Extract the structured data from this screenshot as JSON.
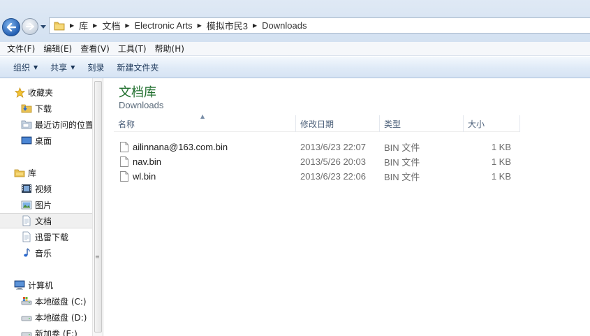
{
  "address_bar": {
    "crumbs": [
      "库",
      "文档",
      "Electronic Arts",
      "模拟市民3",
      "Downloads"
    ]
  },
  "menu": [
    "文件(F)",
    "编辑(E)",
    "查看(V)",
    "工具(T)",
    "帮助(H)"
  ],
  "commands": [
    {
      "label": "组织",
      "has_dropdown": true
    },
    {
      "label": "共享",
      "has_dropdown": true
    },
    {
      "label": "刻录",
      "has_dropdown": false
    },
    {
      "label": "新建文件夹",
      "has_dropdown": false
    }
  ],
  "nav": {
    "favorites": {
      "label": "收藏夹",
      "icon": "star-icon"
    },
    "fav_items": [
      {
        "label": "下载",
        "icon": "downloads-folder-icon"
      },
      {
        "label": "最近访问的位置",
        "icon": "recent-places-icon"
      },
      {
        "label": "桌面",
        "icon": "desktop-icon"
      }
    ],
    "libraries": {
      "label": "库",
      "icon": "library-icon"
    },
    "lib_items": [
      {
        "label": "视频",
        "icon": "video-icon"
      },
      {
        "label": "图片",
        "icon": "picture-icon"
      },
      {
        "label": "文档",
        "icon": "document-icon",
        "selected": true
      },
      {
        "label": "迅雷下载",
        "icon": "document-icon"
      },
      {
        "label": "音乐",
        "icon": "music-icon"
      }
    ],
    "computer": {
      "label": "计算机",
      "icon": "computer-icon"
    },
    "drives": [
      {
        "label": "本地磁盘 (C:)",
        "icon": "system-drive-icon"
      },
      {
        "label": "本地磁盘 (D:)",
        "icon": "drive-icon"
      },
      {
        "label": "新加卷 (E:)",
        "icon": "drive-icon"
      }
    ]
  },
  "content": {
    "title": "文档库",
    "subtitle": "Downloads",
    "columns": {
      "name": "名称",
      "date": "修改日期",
      "type": "类型",
      "size": "大小"
    },
    "files": [
      {
        "name": "ailinnana@163.com.bin",
        "date": "2013/6/23 22:07",
        "type": "BIN 文件",
        "size": "1 KB"
      },
      {
        "name": "nav.bin",
        "date": "2013/5/26 20:03",
        "type": "BIN 文件",
        "size": "1 KB"
      },
      {
        "name": "wl.bin",
        "date": "2013/6/23 22:06",
        "type": "BIN 文件",
        "size": "1 KB"
      }
    ]
  },
  "colors": {
    "title_green": "#1e6e2c",
    "command_text": "#1e395b",
    "header_text": "#4c607a"
  }
}
